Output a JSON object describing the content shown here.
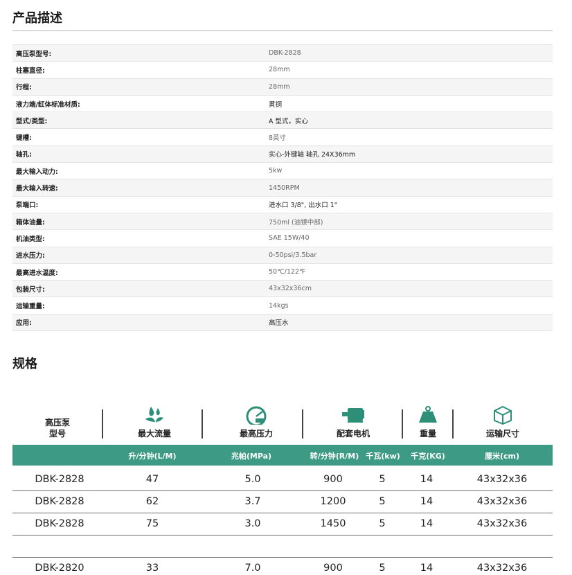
{
  "titles": {
    "description": "产品描述",
    "specs": "规格"
  },
  "description_rows": [
    {
      "label": "高压泵型号:",
      "value": "DBK-2828"
    },
    {
      "label": "柱塞直径:",
      "value": "28mm"
    },
    {
      "label": "行程:",
      "value": "28mm"
    },
    {
      "label": "液力端/缸体标准材质:",
      "value": "黄铜"
    },
    {
      "label": "型式/类型:",
      "value": "A 型式，实心"
    },
    {
      "label": "键槽:",
      "value": "8英寸"
    },
    {
      "label": "轴孔:",
      "value": "实心-外键轴 轴孔 24X36mm"
    },
    {
      "label": "最大输入动力:",
      "value": "5kw"
    },
    {
      "label": "最大输入转速:",
      "value": "1450RPM"
    },
    {
      "label": "泵端口:",
      "value": "进水口 3/8\", 出水口 1\""
    },
    {
      "label": "箱体油量:",
      "value": "750ml (油镜中部)"
    },
    {
      "label": "机油类型:",
      "value": "SAE 15W/40"
    },
    {
      "label": "进水压力:",
      "value": "0-50psi/3.5bar"
    },
    {
      "label": "最高进水温度:",
      "value": "50℃/122℉"
    },
    {
      "label": "包装尺寸:",
      "value": "43x32x36cm"
    },
    {
      "label": "运输重量:",
      "value": "14kgs"
    },
    {
      "label": "应用:",
      "value": "高压水"
    }
  ],
  "spec_header": {
    "model_line1": "高压泵",
    "model_line2": "型号",
    "flow": "最大流量",
    "pressure": "最高压力",
    "motor": "配套电机",
    "weight": "重量",
    "shipping": "运输尺寸"
  },
  "spec_units": {
    "flow": "升/分钟(L/M)",
    "pressure": "兆帕(MPa)",
    "speed": "转/分钟(R/M)",
    "power": "千瓦(kw)",
    "weight": "千克(KG)",
    "size": "厘米(cm)"
  },
  "spec_rows": [
    {
      "model": "DBK-2828",
      "flow": "47",
      "pressure": "5.0",
      "speed": "900",
      "power": "5",
      "weight": "14",
      "size": "43x32x36"
    },
    {
      "model": "DBK-2828",
      "flow": "62",
      "pressure": "3.7",
      "speed": "1200",
      "power": "5",
      "weight": "14",
      "size": "43x32x36"
    },
    {
      "model": "DBK-2828",
      "flow": "75",
      "pressure": "3.0",
      "speed": "1450",
      "power": "5",
      "weight": "14",
      "size": "43x32x36"
    },
    {
      "model": "DBK-2820",
      "flow": "33",
      "pressure": "7.0",
      "speed": "900",
      "power": "5",
      "weight": "14",
      "size": "43x32x36"
    }
  ],
  "colors": {
    "accent": "#3d9a84",
    "icon": "#2e8f78"
  },
  "icons": [
    "water-drops-icon",
    "pressure-gauge-icon",
    "electric-motor-icon",
    "weight-icon",
    "shipping-box-icon"
  ]
}
